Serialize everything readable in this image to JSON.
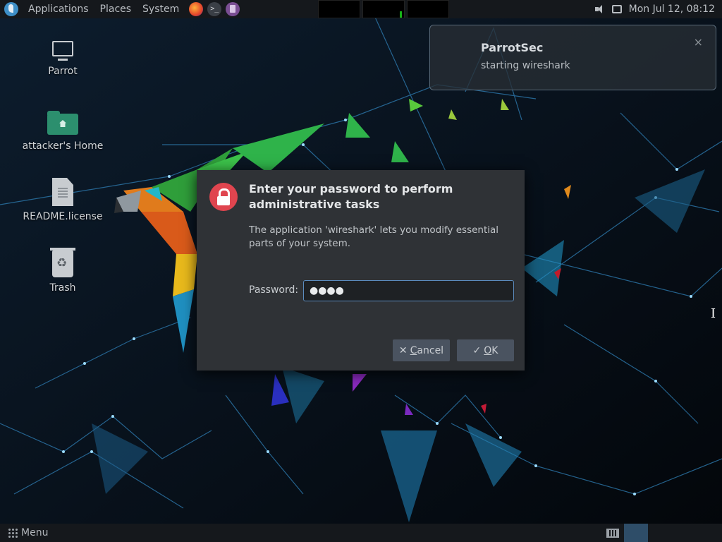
{
  "top_panel": {
    "menus": [
      "Applications",
      "Places",
      "System"
    ],
    "clock": "Mon Jul 12, 08:12"
  },
  "notification": {
    "title": "ParrotSec",
    "body": "starting wireshark",
    "close_glyph": "×"
  },
  "desktop": {
    "icons": [
      {
        "label": "Parrot",
        "icon": "computer-icon"
      },
      {
        "label": "attacker's Home",
        "icon": "home-folder-icon"
      },
      {
        "label": "README.license",
        "icon": "document-icon"
      },
      {
        "label": "Trash",
        "icon": "trash-icon"
      }
    ]
  },
  "dialog": {
    "title": "Enter your password to perform administrative tasks",
    "message": "The application 'wireshark' lets you modify essential parts of your system.",
    "password_label": "Password:",
    "password_value": "●●●●",
    "cancel_icon": "✕",
    "cancel_accel": "C",
    "cancel_rest": "ancel",
    "ok_icon": "✓",
    "ok_accel": "O",
    "ok_rest": "K"
  },
  "bottom_panel": {
    "menu_label": "Menu"
  },
  "colors": {
    "accent_blue": "#5b8bbd",
    "lock_red": "#e0454f",
    "folder_green": "#2c8f6e"
  }
}
